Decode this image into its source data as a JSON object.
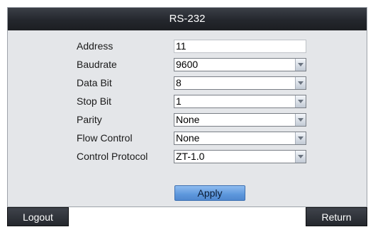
{
  "window": {
    "title": "RS-232"
  },
  "form": {
    "fields": [
      {
        "label": "Address",
        "value": "11",
        "type": "input"
      },
      {
        "label": "Baudrate",
        "value": "9600",
        "type": "select"
      },
      {
        "label": "Data Bit",
        "value": "8",
        "type": "select"
      },
      {
        "label": "Stop Bit",
        "value": "1",
        "type": "select"
      },
      {
        "label": "Parity",
        "value": "None",
        "type": "select"
      },
      {
        "label": "Flow Control",
        "value": "None",
        "type": "select"
      },
      {
        "label": "Control Protocol",
        "value": "ZT-1.0",
        "type": "select"
      }
    ],
    "apply_label": "Apply"
  },
  "bottom": {
    "logout_label": "Logout",
    "return_label": "Return"
  },
  "colors": {
    "titlebar": "#24272d",
    "panel": "#e4e6e9",
    "apply_button": "#5d97dc"
  },
  "icons": {
    "dropdown": "chevron-down-icon"
  }
}
